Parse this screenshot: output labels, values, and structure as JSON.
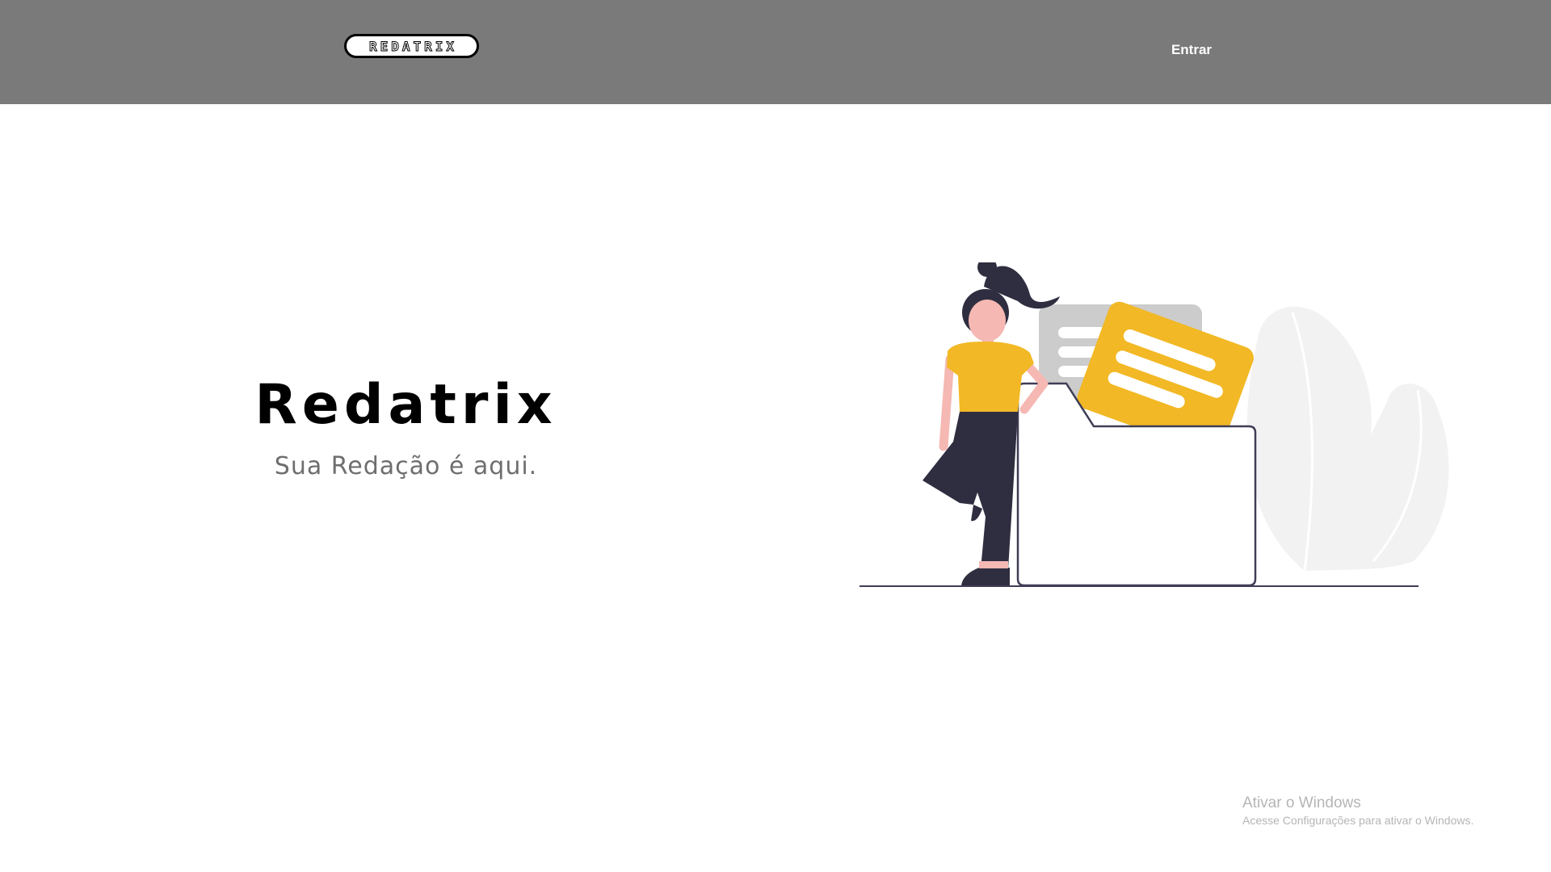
{
  "header": {
    "logo_text": "REDATRIX",
    "login_label": "Entrar"
  },
  "hero": {
    "title": "Redatrix",
    "subtitle": "Sua Redação é aqui."
  },
  "illustration": {
    "description_icon": "woman-with-folder-illustration"
  },
  "os_watermark": {
    "title": "Ativar o Windows",
    "subtitle": "Acesse Configurações para ativar o Windows."
  },
  "colors": {
    "header_bg": "#7a7a7a",
    "accent_yellow": "#f2b825",
    "dark_navy": "#2f2e41",
    "skin": "#f5b8b3",
    "light_gray": "#f2f2f2",
    "mid_gray": "#cccccc",
    "subtitle_gray": "#6e6e6e"
  }
}
